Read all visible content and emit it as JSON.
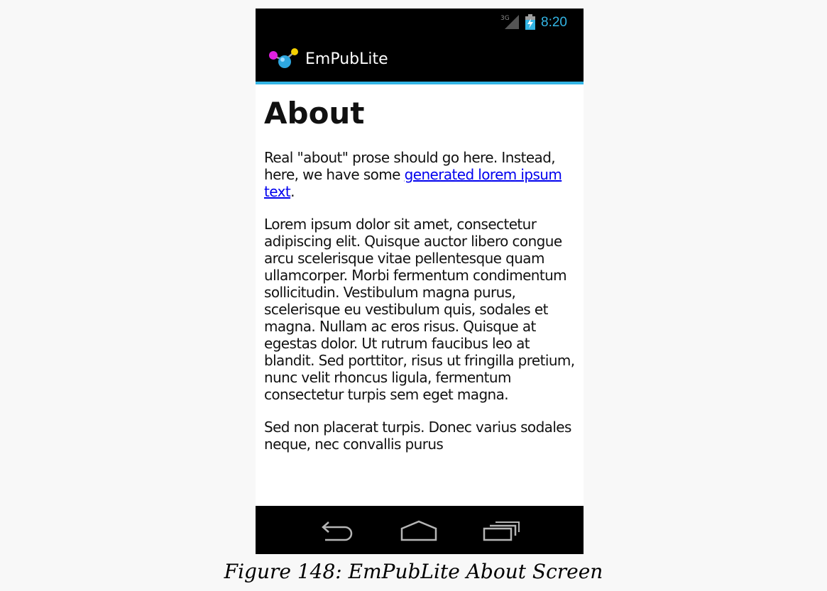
{
  "status_bar": {
    "network_label": "3G",
    "network_icon": "signal-3g-icon",
    "battery_icon": "battery-charging-icon",
    "time": "8:20"
  },
  "action_bar": {
    "app_icon": "empublite-logo-icon",
    "title": "EmPubLite"
  },
  "content": {
    "heading": "About",
    "intro_before_link": "Real \"about\" prose should go here. Instead, here, we have some ",
    "intro_link": "generated lorem ipsum text",
    "intro_after_link": ".",
    "paragraph_2": "Lorem ipsum dolor sit amet, consectetur adipiscing elit. Quisque auctor libero congue arcu scelerisque vitae pellentesque quam ullamcorper. Morbi fermentum condimentum sollicitudin. Vestibulum magna purus, scelerisque eu vestibulum quis, sodales et magna. Nullam ac eros risus. Quisque at egestas dolor. Ut rutrum faucibus leo at blandit. Sed porttitor, risus ut fringilla pretium, nunc velit rhoncus ligula, fermentum consectetur turpis sem eget magna.",
    "paragraph_3": "Sed non placerat turpis. Donec varius sodales neque, nec convallis purus"
  },
  "nav_bar": {
    "back_icon": "back-icon",
    "home_icon": "home-icon",
    "recents_icon": "recent-apps-icon"
  },
  "caption": "Figure 148: EmPubLite About Screen",
  "colors": {
    "accent": "#33b5e5",
    "bar_background": "#000000",
    "link": "#0000ee"
  }
}
